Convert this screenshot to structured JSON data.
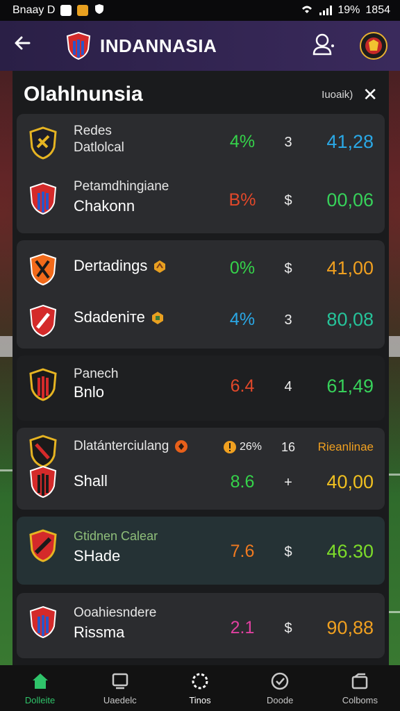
{
  "status_bar": {
    "left_text": "Bnaay D",
    "battery": "19%",
    "time": "1854"
  },
  "app_bar": {
    "title": "INDANNASIA",
    "back_icon": "arrow-left-icon",
    "user_icon": "user-icon"
  },
  "panel": {
    "title": "Olahlnunsia",
    "link": "Iuoaik)",
    "close_icon": "close-icon"
  },
  "cards": [
    {
      "rows": [
        {
          "line1": "Redes",
          "line2": "Datlolcal",
          "pct": "4%",
          "pct_color": "#35d34a",
          "mid": "3",
          "odds": "41,28",
          "odds_color": "#2aa8e6"
        },
        {
          "line1": "Petamdhingiane",
          "line2": "Chakonn",
          "pct": "B%",
          "pct_color": "#e2482a",
          "mid": "$",
          "odds": "00,06",
          "odds_color": "#37d15a"
        }
      ]
    },
    {
      "rows": [
        {
          "line1": "",
          "line2": "Dertadings",
          "pct": "0%",
          "pct_color": "#35d34a",
          "mid": "$",
          "odds": "41,00",
          "odds_color": "#f0a020"
        },
        {
          "line1": "",
          "line2": "Sdadeniте",
          "pct": "4%",
          "pct_color": "#2aa8e6",
          "mid": "3",
          "odds": "80,08",
          "odds_color": "#26c39a"
        }
      ]
    },
    {
      "rows": [
        {
          "line1": "Panech",
          "line2": "Bnlo",
          "pct": "6.4",
          "pct_color": "#e2482a",
          "mid": "4",
          "odds": "61,49",
          "odds_color": "#37d15a"
        }
      ]
    },
    {
      "rows": [
        {
          "line1": "Dlatánterciulang",
          "line2": "",
          "pct": "26%",
          "pct_color": "#f0f0f0",
          "mid": "16",
          "odds": "Rieanlinae",
          "odds_color": "#f0a020"
        },
        {
          "line1": "",
          "line2": "Shall",
          "pct": "8.6",
          "pct_color": "#35d34a",
          "mid": "+",
          "odds": "40,00",
          "odds_color": "#f0c020"
        }
      ]
    },
    {
      "rows": [
        {
          "line1": "Gtidnen Calear",
          "line2": "SHade",
          "pct": "7.6",
          "pct_color": "#f07a20",
          "mid": "$",
          "odds": "46.30",
          "odds_color": "#7ddc2a"
        }
      ]
    },
    {
      "rows": [
        {
          "line1": "Ooahiesndere",
          "line2": "Rissma",
          "pct": "2.1",
          "pct_color": "#e040a0",
          "mid": "$",
          "odds": "90,88",
          "odds_color": "#f0a020"
        }
      ]
    }
  ],
  "bottom_nav": [
    {
      "label": "Dolleite",
      "icon": "home-icon",
      "active": true
    },
    {
      "label": "Uaedelc",
      "icon": "tv-icon",
      "active": false
    },
    {
      "label": "Tinos",
      "icon": "dotted-circle-icon",
      "active": false
    },
    {
      "label": "Doode",
      "icon": "check-circle-icon",
      "active": false
    },
    {
      "label": "Colboms",
      "icon": "wallet-icon",
      "active": false
    }
  ]
}
